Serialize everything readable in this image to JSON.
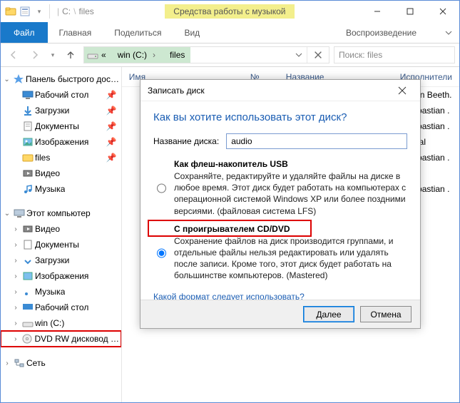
{
  "titlebar": {
    "path_drive": "C:",
    "path_folder": "files",
    "contextual_tab": "Средства работы с музыкой"
  },
  "ribbon": {
    "file": "Файл",
    "home": "Главная",
    "share": "Поделиться",
    "view": "Вид",
    "playback": "Воспроизведение"
  },
  "navbar": {
    "addr_root": "«",
    "addr_drive": "win  (C:)",
    "addr_folder": "files",
    "search_placeholder": "Поиск: files"
  },
  "columns": {
    "name": "Имя",
    "num": "№",
    "title": "Название",
    "artist": "Исполнители"
  },
  "rows": [
    {
      "artist": "dwig Van Beeth."
    },
    {
      "artist": "ann Sebastian ."
    },
    {
      "artist": "ann Sebastian ."
    },
    {
      "artist": "trumental"
    },
    {
      "artist": "ann Sebastian ."
    },
    {
      "artist": ""
    },
    {
      "artist": "ann Sebastian ."
    }
  ],
  "tree": {
    "quick_access": "Панель быстрого доступа",
    "desktop": "Рабочий стол",
    "downloads": "Загрузки",
    "documents": "Документы",
    "pictures": "Изображения",
    "files": "files",
    "videos": "Видео",
    "music": "Музыка",
    "this_pc": "Этот компьютер",
    "pc_videos": "Видео",
    "pc_documents": "Документы",
    "pc_downloads": "Загрузки",
    "pc_pictures": "Изображения",
    "pc_music": "Музыка",
    "pc_desktop": "Рабочий стол",
    "pc_drive": "win (C:)",
    "pc_dvd": "DVD RW дисковод (E:)",
    "network": "Сеть"
  },
  "dialog": {
    "title": "Записать диск",
    "question": "Как вы хотите использовать этот диск?",
    "disc_label_caption": "Название диска:",
    "disc_label_value": "audio",
    "opt1_title": "Как флеш-накопитель USB",
    "opt1_desc": "Сохраняйте, редактируйте и удаляйте файлы на диске в любое время. Этот диск будет работать на компьютерах с операционной системой Windows XP или более поздними версиями. (файловая система LFS)",
    "opt2_title": "С проигрывателем CD/DVD",
    "opt2_desc": "Сохранение файлов на диск производится группами, и отдельные файлы нельзя редактировать или удалять после записи. Кроме того, этот диск будет работать на большинстве компьютеров. (Mastered)",
    "help_link": "Какой формат следует использовать?",
    "next": "Далее",
    "cancel": "Отмена"
  }
}
